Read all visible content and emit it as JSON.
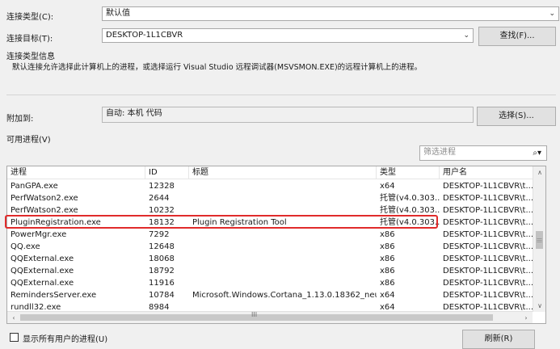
{
  "connection_type": {
    "label": "连接类型(C):",
    "value": "默认值"
  },
  "connection_target": {
    "label": "连接目标(T):",
    "value": "DESKTOP-1L1CBVR",
    "find_button": "查找(F)..."
  },
  "connection_info": {
    "heading": "连接类型信息",
    "text": "默认连接允许选择此计算机上的进程，或选择运行 Visual Studio 远程调试器(MSVSMON.EXE)的远程计算机上的进程。"
  },
  "attach_to": {
    "label": "附加到:",
    "value": "自动: 本机 代码",
    "select_button": "选择(S)..."
  },
  "available_processes": {
    "label": "可用进程(V)",
    "filter_placeholder": "筛选进程",
    "columns": [
      "进程",
      "ID",
      "标题",
      "类型",
      "用户名"
    ],
    "rows": [
      [
        "PanGPA.exe",
        "12328",
        "",
        "x64",
        "DESKTOP-1L1CBVR\\t..."
      ],
      [
        "PerfWatson2.exe",
        "2644",
        "",
        "托管(v4.0.303...",
        "DESKTOP-1L1CBVR\\t..."
      ],
      [
        "PerfWatson2.exe",
        "10232",
        "",
        "托管(v4.0.303...",
        "DESKTOP-1L1CBVR\\t..."
      ],
      [
        "PluginRegistration.exe",
        "18132",
        "Plugin Registration Tool",
        "托管(v4.0.303...",
        "DESKTOP-1L1CBVR\\t..."
      ],
      [
        "PowerMgr.exe",
        "7292",
        "",
        "x86",
        "DESKTOP-1L1CBVR\\t..."
      ],
      [
        "QQ.exe",
        "12648",
        "",
        "x86",
        "DESKTOP-1L1CBVR\\t..."
      ],
      [
        "QQExternal.exe",
        "18068",
        "",
        "x86",
        "DESKTOP-1L1CBVR\\t..."
      ],
      [
        "QQExternal.exe",
        "18792",
        "",
        "x86",
        "DESKTOP-1L1CBVR\\t..."
      ],
      [
        "QQExternal.exe",
        "11916",
        "",
        "x86",
        "DESKTOP-1L1CBVR\\t..."
      ],
      [
        "RemindersServer.exe",
        "10784",
        "Microsoft.Windows.Cortana_1.13.0.18362_neut...",
        "x64",
        "DESKTOP-1L1CBVR\\t..."
      ],
      [
        "rundll32.exe",
        "8984",
        "",
        "x64",
        "DESKTOP-1L1CBVR\\t..."
      ]
    ]
  },
  "show_all_users": {
    "label": "显示所有用户的进程(U)"
  },
  "refresh_button": "刷新(R)",
  "colors": {
    "highlight": "#e02b2b",
    "window_bg": "#f0f0f0",
    "border": "#a9a9a9"
  }
}
